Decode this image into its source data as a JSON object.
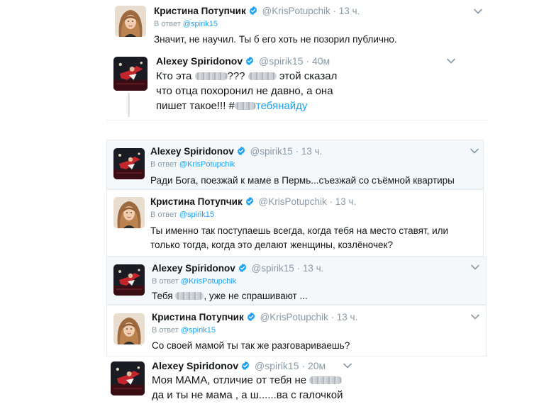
{
  "users": {
    "kristina": {
      "name": "Кристина Потупчик",
      "handle": "@KrisPotupchik"
    },
    "alexey": {
      "name": "Alexey Spiridonov",
      "handle": "@spirik15"
    }
  },
  "reply_prefix": "В ответ",
  "dot": "·",
  "tweets": [
    {
      "user": "kristina",
      "time": "13 ч.",
      "reply_to": "@spirik15",
      "text": "Значит, не научил. Ты б его хоть не позорил публично."
    },
    {
      "user": "alexey",
      "time": "40м",
      "text_parts": [
        "Кто эта ",
        "??? ",
        " этой сказал",
        "что отца похоронил не давно, а она",
        "пишет такое!!! #",
        "тебянайду"
      ]
    },
    {
      "user": "alexey",
      "time": "13 ч.",
      "reply_to": "@KrisPotupchik",
      "text": "Ради Бога, поезжай к маме в Пермь...съезжай со съёмной квартиры"
    },
    {
      "user": "kristina",
      "time": "13 ч.",
      "reply_to": "@spirik15",
      "text": "Ты именно так поступаешь всегда, когда тебя на место ставят, или только тогда, когда это делают женщины, козлёночек?"
    },
    {
      "user": "alexey",
      "time": "13 ч.",
      "reply_to": "@KrisPotupchik",
      "text_parts": [
        "Тебя ",
        ", уже не спрашивают ..."
      ]
    },
    {
      "user": "kristina",
      "time": "13 ч.",
      "reply_to": "@spirik15",
      "text": "Со своей мамой ты так же разговариваешь?"
    },
    {
      "user": "alexey",
      "time": "20м",
      "text_parts": [
        "Моя МАМА, отличие от тебя не ",
        "да и ты не мама , а ш......ва с галочкой"
      ]
    }
  ],
  "icons": {
    "verified": "verified-badge-icon",
    "more": "chevron-down-icon",
    "avatar_kristina": "kristina-avatar",
    "avatar_alexey": "alexey-avatar"
  },
  "colors": {
    "link": "#1da1f2",
    "muted": "#8899a6",
    "border": "#e6ecf0",
    "highlight": "#f5f8fa",
    "text": "#14171a"
  }
}
